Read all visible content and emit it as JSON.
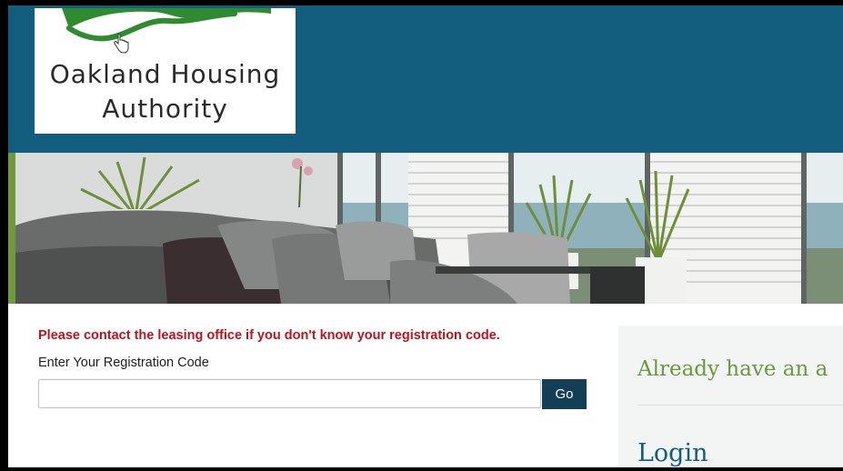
{
  "header": {
    "logo_line1": "Oakland Housing",
    "logo_line2": "Authority",
    "colors": {
      "header_bg": "#135e7e",
      "leaf_green": "#2e8b2e"
    }
  },
  "banner": {
    "description_icon": "living-room-photo"
  },
  "registration": {
    "notice": "Please contact the leasing office if you don't know your registration code.",
    "label": "Enter Your Registration Code",
    "input_value": "",
    "go_label": "Go"
  },
  "side_panel": {
    "heading": "Already have an a",
    "login_heading": "Login"
  },
  "colors": {
    "notice_red": "#c0121a",
    "button_bg": "#123f55",
    "side_heading_green": "#6a9a3c"
  }
}
